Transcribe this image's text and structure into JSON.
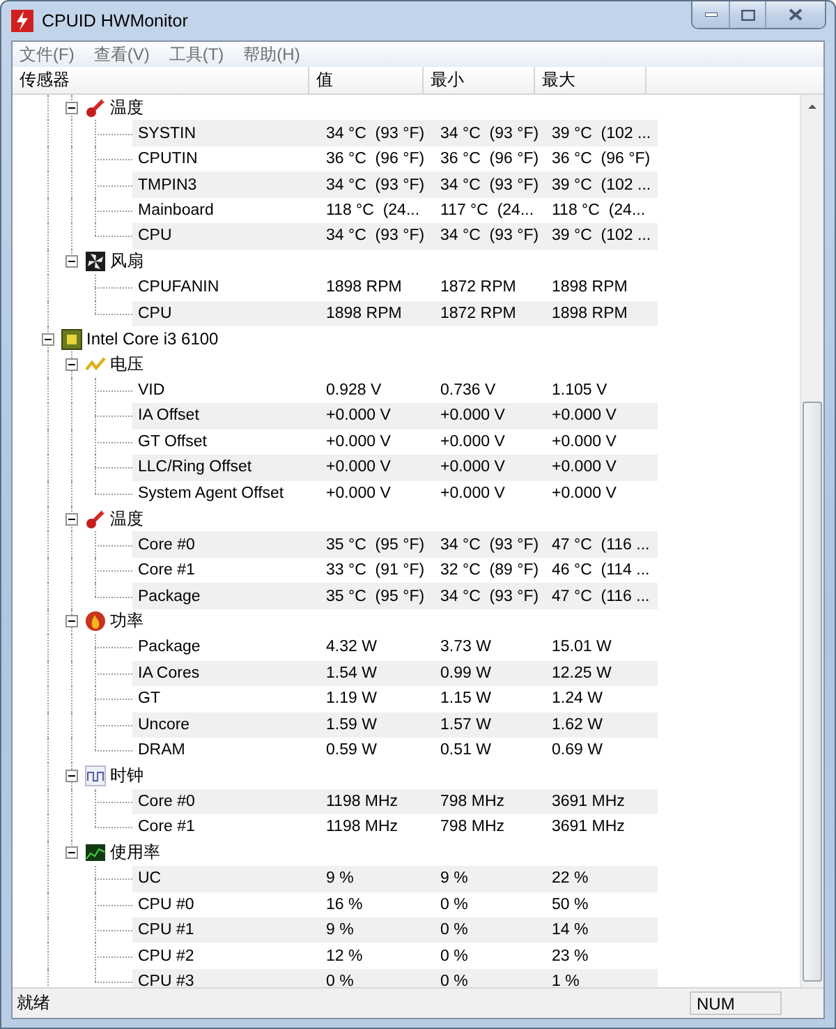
{
  "window": {
    "title": "CPUID HWMonitor"
  },
  "menu": [
    {
      "label": "文件(F)"
    },
    {
      "label": "查看(V)"
    },
    {
      "label": "工具(T)"
    },
    {
      "label": "帮助(H)"
    }
  ],
  "columns": [
    "传感器",
    "值",
    "最小",
    "最大"
  ],
  "tree": [
    {
      "children": [
        {
          "label": "温度",
          "kind": "temperature",
          "expanded": true,
          "children": [
            {
              "label": "SYSTIN",
              "value": "34 °C  (93 °F)",
              "min": "34 °C  (93 °F)",
              "max": "39 °C  (102 ..."
            },
            {
              "label": "CPUTIN",
              "value": "36 °C  (96 °F)",
              "min": "36 °C  (96 °F)",
              "max": "36 °C  (96 °F)"
            },
            {
              "label": "TMPIN3",
              "value": "34 °C  (93 °F)",
              "min": "34 °C  (93 °F)",
              "max": "39 °C  (102 ..."
            },
            {
              "label": "Mainboard",
              "value": "118 °C  (24...",
              "min": "117 °C  (24...",
              "max": "118 °C  (24..."
            },
            {
              "label": "CPU",
              "value": "34 °C  (93 °F)",
              "min": "34 °C  (93 °F)",
              "max": "39 °C  (102 ..."
            }
          ]
        },
        {
          "label": "风扇",
          "kind": "fan",
          "expanded": true,
          "children": [
            {
              "label": "CPUFANIN",
              "value": "1898 RPM",
              "min": "1872 RPM",
              "max": "1898 RPM"
            },
            {
              "label": "CPU",
              "value": "1898 RPM",
              "min": "1872 RPM",
              "max": "1898 RPM"
            }
          ]
        }
      ]
    },
    {
      "label": "Intel Core i3 6100",
      "kind": "cpu",
      "expanded": true,
      "children": [
        {
          "label": "电压",
          "kind": "voltage",
          "expanded": true,
          "children": [
            {
              "label": "VID",
              "value": "0.928 V",
              "min": "0.736 V",
              "max": "1.105 V"
            },
            {
              "label": "IA Offset",
              "value": "+0.000 V",
              "min": "+0.000 V",
              "max": "+0.000 V"
            },
            {
              "label": "GT Offset",
              "value": "+0.000 V",
              "min": "+0.000 V",
              "max": "+0.000 V"
            },
            {
              "label": "LLC/Ring Offset",
              "value": "+0.000 V",
              "min": "+0.000 V",
              "max": "+0.000 V"
            },
            {
              "label": "System Agent Offset",
              "value": "+0.000 V",
              "min": "+0.000 V",
              "max": "+0.000 V"
            }
          ]
        },
        {
          "label": "温度",
          "kind": "temperature",
          "expanded": true,
          "children": [
            {
              "label": "Core #0",
              "value": "35 °C  (95 °F)",
              "min": "34 °C  (93 °F)",
              "max": "47 °C  (116 ..."
            },
            {
              "label": "Core #1",
              "value": "33 °C  (91 °F)",
              "min": "32 °C  (89 °F)",
              "max": "46 °C  (114 ..."
            },
            {
              "label": "Package",
              "value": "35 °C  (95 °F)",
              "min": "34 °C  (93 °F)",
              "max": "47 °C  (116 ..."
            }
          ]
        },
        {
          "label": "功率",
          "kind": "power",
          "expanded": true,
          "children": [
            {
              "label": "Package",
              "value": "4.32 W",
              "min": "3.73 W",
              "max": "15.01 W"
            },
            {
              "label": "IA Cores",
              "value": "1.54 W",
              "min": "0.99 W",
              "max": "12.25 W"
            },
            {
              "label": "GT",
              "value": "1.19 W",
              "min": "1.15 W",
              "max": "1.24 W"
            },
            {
              "label": "Uncore",
              "value": "1.59 W",
              "min": "1.57 W",
              "max": "1.62 W"
            },
            {
              "label": "DRAM",
              "value": "0.59 W",
              "min": "0.51 W",
              "max": "0.69 W"
            }
          ]
        },
        {
          "label": "时钟",
          "kind": "clock",
          "expanded": true,
          "children": [
            {
              "label": "Core #0",
              "value": "1198 MHz",
              "min": "798 MHz",
              "max": "3691 MHz"
            },
            {
              "label": "Core #1",
              "value": "1198 MHz",
              "min": "798 MHz",
              "max": "3691 MHz"
            }
          ]
        },
        {
          "label": "使用率",
          "kind": "utilization",
          "expanded": true,
          "children": [
            {
              "label": "UC",
              "value": "9 %",
              "min": "9 %",
              "max": "22 %"
            },
            {
              "label": "CPU #0",
              "value": "16 %",
              "min": "0 %",
              "max": "50 %"
            },
            {
              "label": "CPU #1",
              "value": "9 %",
              "min": "0 %",
              "max": "14 %"
            },
            {
              "label": "CPU #2",
              "value": "12 %",
              "min": "0 %",
              "max": "23 %"
            },
            {
              "label": "CPU #3",
              "value": "0 %",
              "min": "0 %",
              "max": "1 %"
            }
          ]
        }
      ]
    }
  ],
  "status_bar": {
    "text": "就绪",
    "indicator": "NUM"
  }
}
